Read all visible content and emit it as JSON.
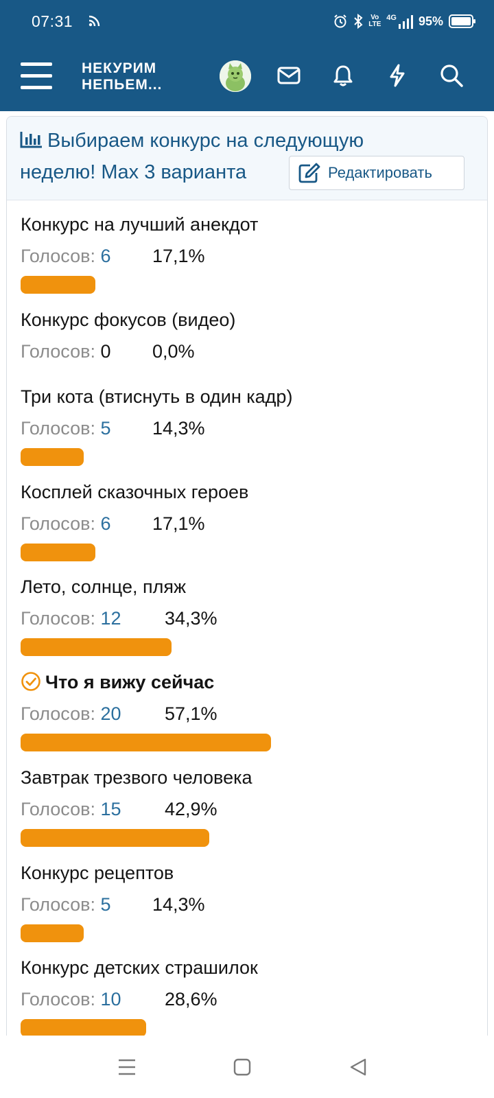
{
  "status_bar": {
    "time": "07:31",
    "battery": "95%",
    "network": "4G",
    "volte": "Vo LTE",
    "icons": [
      "cast-icon",
      "alarm-icon",
      "bluetooth-icon",
      "signal-icon",
      "battery-icon"
    ]
  },
  "header": {
    "logo_line1": "НЕКУРИМ",
    "logo_line2": "НЕПЬЕМ...",
    "icons": [
      "menu-icon",
      "avatar",
      "mail-icon",
      "bell-icon",
      "lightning-icon",
      "search-icon"
    ]
  },
  "poll": {
    "title": "Выбираем конкурс на следующую неделю! Max 3 варианта",
    "title_line1": "Выбираем конкурс на следующую",
    "title_line2": "неделю! Max 3 варианта",
    "edit_label": "Редактировать",
    "votes_label": "Голосов:",
    "accent_color": "#f0920d",
    "link_color": "#185886",
    "options": [
      {
        "label": "Конкурс на лучший анекдот",
        "votes": "6",
        "percent": "17,1%",
        "share": 0.171,
        "winner": false
      },
      {
        "label": "Конкурс фокусов (видео)",
        "votes": "0",
        "percent": "0,0%",
        "share": 0.0,
        "winner": false
      },
      {
        "label": "Три кота (втиснуть в один кадр)",
        "votes": "5",
        "percent": "14,3%",
        "share": 0.143,
        "winner": false
      },
      {
        "label": "Косплей сказочных героев",
        "votes": "6",
        "percent": "17,1%",
        "share": 0.171,
        "winner": false
      },
      {
        "label": "Лето, солнце, пляж",
        "votes": "12",
        "percent": "34,3%",
        "share": 0.343,
        "winner": false
      },
      {
        "label": "Что я вижу сейчас",
        "votes": "20",
        "percent": "57,1%",
        "share": 0.571,
        "winner": true
      },
      {
        "label": "Завтрак трезвого человека",
        "votes": "15",
        "percent": "42,9%",
        "share": 0.429,
        "winner": false
      },
      {
        "label": "Конкурс рецептов",
        "votes": "5",
        "percent": "14,3%",
        "share": 0.143,
        "winner": false
      },
      {
        "label": "Конкурс детских страшилок",
        "votes": "10",
        "percent": "28,6%",
        "share": 0.286,
        "winner": false
      }
    ]
  },
  "navigation": {
    "icons": [
      "recents-icon",
      "home-icon",
      "back-icon"
    ]
  }
}
